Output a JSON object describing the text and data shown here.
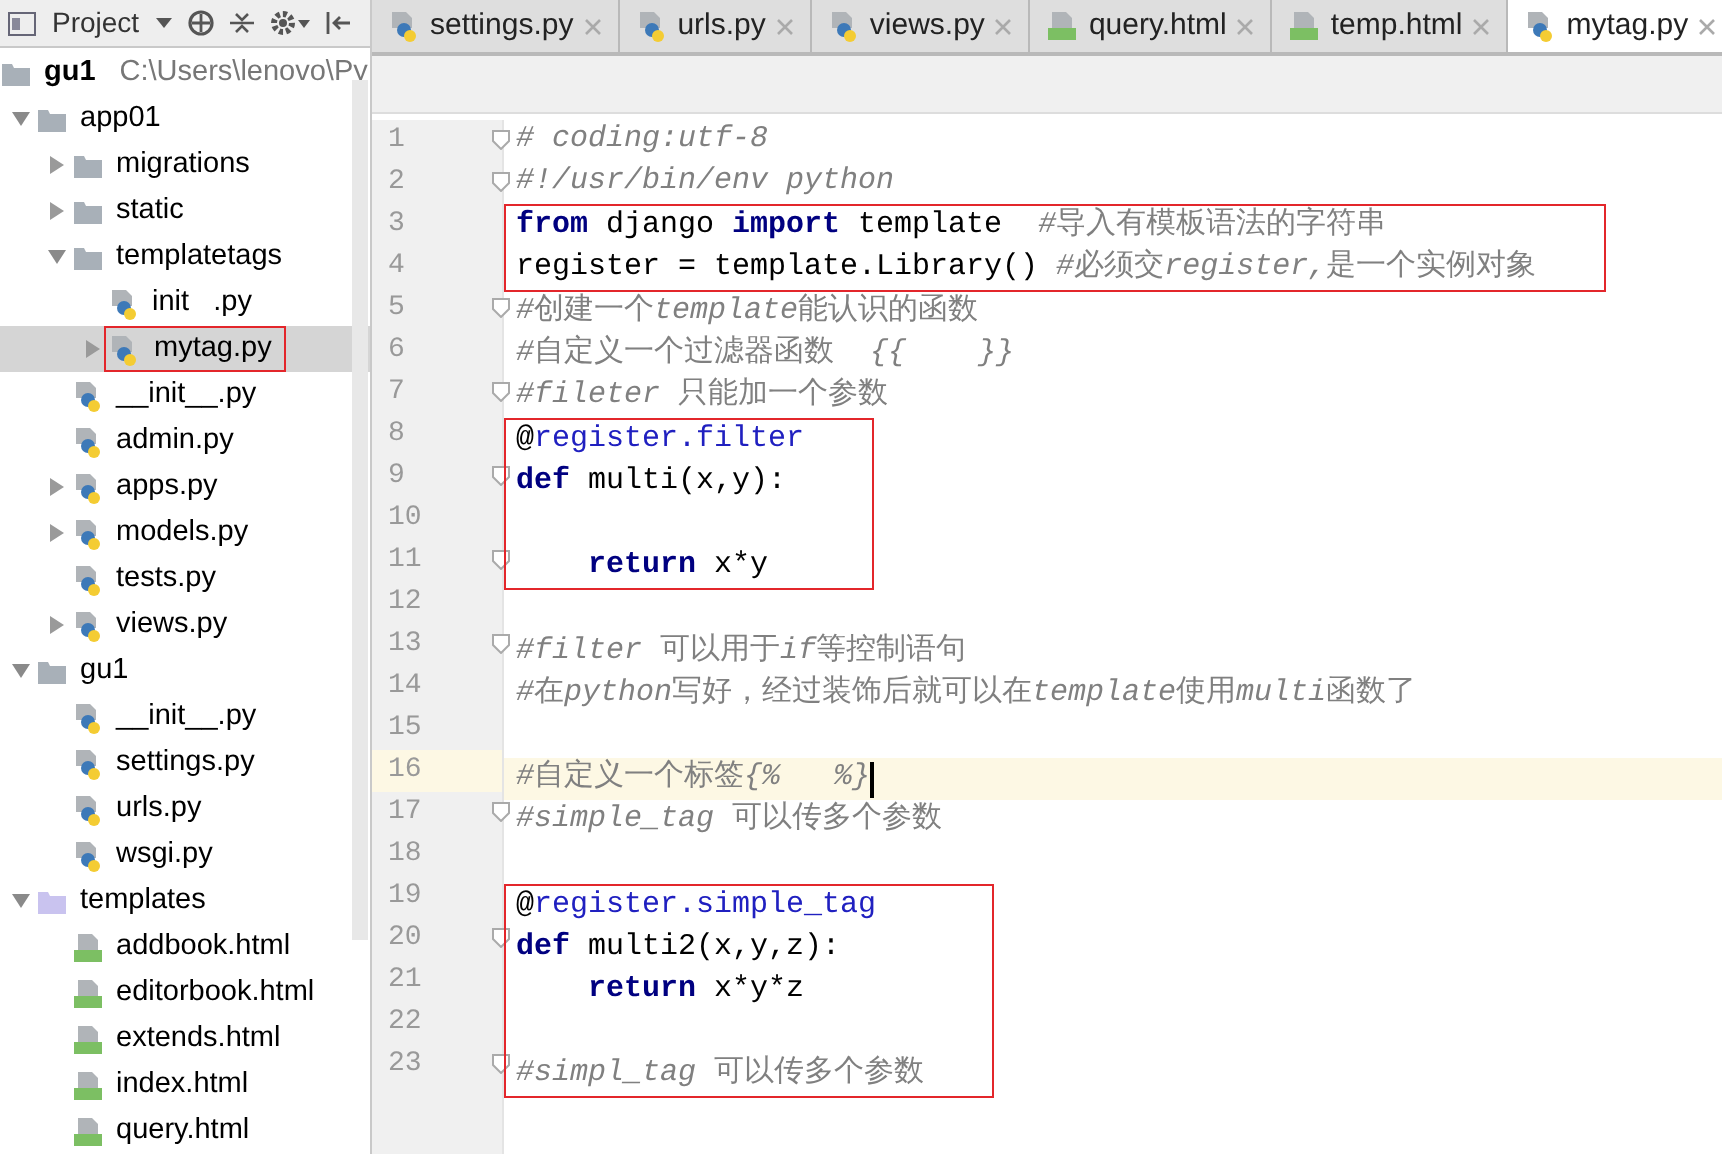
{
  "project_toolbar": {
    "title": "Project"
  },
  "tabs": [
    {
      "label": "settings.py",
      "kind": "python",
      "selected": false
    },
    {
      "label": "urls.py",
      "kind": "python",
      "selected": false
    },
    {
      "label": "views.py",
      "kind": "python",
      "selected": false
    },
    {
      "label": "query.html",
      "kind": "html",
      "selected": false
    },
    {
      "label": "temp.html",
      "kind": "html",
      "selected": false
    },
    {
      "label": "mytag.py",
      "kind": "python",
      "selected": true
    }
  ],
  "tree": [
    {
      "label": "gu1",
      "path": "C:\\Users\\lenovo\\Py",
      "kind": "folder",
      "selected": false,
      "annotated": false,
      "children": [
        {
          "label": "app01",
          "kind": "folder",
          "expanded": true,
          "selected": false,
          "annotated": false,
          "children": [
            {
              "label": "migrations",
              "kind": "folder",
              "expanded": false,
              "selected": false,
              "annotated": false
            },
            {
              "label": "static",
              "kind": "folder",
              "expanded": false,
              "selected": false,
              "annotated": false
            },
            {
              "label": "templatetags",
              "kind": "folder",
              "expanded": true,
              "selected": false,
              "annotated": false,
              "children": [
                {
                  "label": "init   .py",
                  "kind": "python",
                  "selected": false,
                  "annotated": false
                },
                {
                  "label": "mytag.py",
                  "kind": "python",
                  "expanded": false,
                  "selected": true,
                  "annotated": true
                }
              ]
            },
            {
              "label": "__init__.py",
              "kind": "python",
              "selected": false,
              "annotated": false
            },
            {
              "label": "admin.py",
              "kind": "python",
              "selected": false,
              "annotated": false
            },
            {
              "label": "apps.py",
              "kind": "python",
              "expanded": false,
              "selected": false,
              "annotated": false
            },
            {
              "label": "models.py",
              "kind": "python",
              "expanded": false,
              "selected": false,
              "annotated": false
            },
            {
              "label": "tests.py",
              "kind": "python",
              "selected": false,
              "annotated": false
            },
            {
              "label": "views.py",
              "kind": "python",
              "expanded": false,
              "selected": false,
              "annotated": false
            }
          ]
        },
        {
          "label": "gu1",
          "kind": "folder",
          "expanded": true,
          "selected": false,
          "annotated": false,
          "children": [
            {
              "label": "__init__.py",
              "kind": "python",
              "selected": false,
              "annotated": false
            },
            {
              "label": "settings.py",
              "kind": "python",
              "selected": false,
              "annotated": false
            },
            {
              "label": "urls.py",
              "kind": "python",
              "selected": false,
              "annotated": false
            },
            {
              "label": "wsgi.py",
              "kind": "python",
              "selected": false,
              "annotated": false
            }
          ]
        },
        {
          "label": "templates",
          "kind": "resource-folder",
          "expanded": true,
          "selected": false,
          "annotated": false,
          "children": [
            {
              "label": "addbook.html",
              "kind": "html",
              "selected": false,
              "annotated": false
            },
            {
              "label": "editorbook.html",
              "kind": "html",
              "selected": false,
              "annotated": false
            },
            {
              "label": "extends.html",
              "kind": "html",
              "selected": false,
              "annotated": false
            },
            {
              "label": "index.html",
              "kind": "html",
              "selected": false,
              "annotated": false
            },
            {
              "label": "query.html",
              "kind": "html",
              "selected": false,
              "annotated": false
            }
          ]
        }
      ]
    }
  ],
  "code_blocks": [
    {
      "boxed": false,
      "lines": [
        {
          "number": "1",
          "fold": true,
          "current": false,
          "tokens": [
            {
              "kind": "comment-latin",
              "text": "# coding:utf-8"
            }
          ]
        },
        {
          "number": "2",
          "fold": true,
          "current": false,
          "tokens": [
            {
              "kind": "comment-latin",
              "text": "#!/usr/bin/env python"
            }
          ]
        }
      ]
    },
    {
      "boxed": true,
      "lines": [
        {
          "number": "3",
          "fold": false,
          "current": false,
          "tokens": [
            {
              "kind": "keyword",
              "text": "from"
            },
            {
              "kind": "plain",
              "text": " django "
            },
            {
              "kind": "keyword",
              "text": "import"
            },
            {
              "kind": "plain",
              "text": " template  "
            },
            {
              "kind": "comment-latin",
              "text": "#"
            },
            {
              "kind": "comment",
              "text": "导入有模板语法的字符串"
            }
          ]
        },
        {
          "number": "4",
          "fold": false,
          "current": false,
          "tokens": [
            {
              "kind": "plain",
              "text": "register = template.Library() "
            },
            {
              "kind": "comment-latin",
              "text": "#"
            },
            {
              "kind": "comment",
              "text": "必须交"
            },
            {
              "kind": "comment-latin",
              "text": "register,"
            },
            {
              "kind": "comment",
              "text": "是一个实例对象"
            }
          ]
        }
      ]
    },
    {
      "boxed": false,
      "lines": [
        {
          "number": "5",
          "fold": true,
          "current": false,
          "tokens": [
            {
              "kind": "comment-latin",
              "text": "#"
            },
            {
              "kind": "comment",
              "text": "创建一个"
            },
            {
              "kind": "comment-latin",
              "text": "template"
            },
            {
              "kind": "comment",
              "text": "能认识的函数"
            }
          ]
        },
        {
          "number": "6",
          "fold": false,
          "current": false,
          "tokens": [
            {
              "kind": "comment-latin",
              "text": "#"
            },
            {
              "kind": "comment",
              "text": "自定义一个过滤器函数  "
            },
            {
              "kind": "comment-latin",
              "text": "{{    }}"
            }
          ]
        },
        {
          "number": "7",
          "fold": true,
          "current": false,
          "tokens": [
            {
              "kind": "comment-latin",
              "text": "#fileter"
            },
            {
              "kind": "comment",
              "text": " 只能加一个参数"
            }
          ]
        }
      ]
    },
    {
      "boxed": true,
      "lines": [
        {
          "number": "8",
          "fold": false,
          "current": false,
          "tokens": [
            {
              "kind": "plain",
              "text": "@"
            },
            {
              "kind": "decorator",
              "text": "register.filter"
            }
          ]
        },
        {
          "number": "9",
          "fold": true,
          "current": false,
          "tokens": [
            {
              "kind": "keyword",
              "text": "def"
            },
            {
              "kind": "plain",
              "text": " multi(x,y):"
            }
          ]
        },
        {
          "number": "10",
          "fold": false,
          "current": false
        },
        {
          "number": "11",
          "fold": true,
          "current": false,
          "indented": true,
          "tokens": [
            {
              "kind": "keyword",
              "text": "return"
            },
            {
              "kind": "plain",
              "text": " x*y"
            }
          ]
        }
      ]
    },
    {
      "boxed": false,
      "lines": [
        {
          "number": "12",
          "fold": false,
          "current": false
        },
        {
          "number": "13",
          "fold": true,
          "current": false,
          "tokens": [
            {
              "kind": "comment-latin",
              "text": "#filter"
            },
            {
              "kind": "comment",
              "text": " 可以用于"
            },
            {
              "kind": "comment-latin",
              "text": "if"
            },
            {
              "kind": "comment",
              "text": "等控制语句"
            }
          ]
        },
        {
          "number": "14",
          "fold": false,
          "current": false,
          "tokens": [
            {
              "kind": "comment-latin",
              "text": "#"
            },
            {
              "kind": "comment",
              "text": "在"
            },
            {
              "kind": "comment-latin",
              "text": "python"
            },
            {
              "kind": "comment",
              "text": "写好，经过装饰后就可以在"
            },
            {
              "kind": "comment-latin",
              "text": "template"
            },
            {
              "kind": "comment",
              "text": "使用"
            },
            {
              "kind": "comment-latin",
              "text": "multi"
            },
            {
              "kind": "comment",
              "text": "函数了"
            }
          ]
        },
        {
          "number": "15",
          "fold": false,
          "current": false
        },
        {
          "number": "16",
          "fold": false,
          "current": true,
          "tokens": [
            {
              "kind": "comment-latin",
              "text": "#"
            },
            {
              "kind": "comment",
              "text": "自定义一个标签"
            },
            {
              "kind": "comment-latin",
              "text": "{%   %}"
            }
          ]
        },
        {
          "number": "17",
          "fold": true,
          "current": false,
          "tokens": [
            {
              "kind": "comment-latin",
              "text": "#simple_tag"
            },
            {
              "kind": "comment",
              "text": " 可以传多个参数"
            }
          ]
        },
        {
          "number": "18",
          "fold": false,
          "current": false
        }
      ]
    },
    {
      "boxed": true,
      "lines": [
        {
          "number": "19",
          "fold": false,
          "current": false,
          "tokens": [
            {
              "kind": "plain",
              "text": "@"
            },
            {
              "kind": "decorator",
              "text": "register.simple_tag"
            }
          ]
        },
        {
          "number": "20",
          "fold": true,
          "current": false,
          "tokens": [
            {
              "kind": "keyword",
              "text": "def"
            },
            {
              "kind": "plain",
              "text": " multi2(x,y,z):"
            }
          ]
        },
        {
          "number": "21",
          "fold": false,
          "current": false,
          "indented": true,
          "tokens": [
            {
              "kind": "keyword",
              "text": "return"
            },
            {
              "kind": "plain",
              "text": " x*y*z"
            }
          ]
        },
        {
          "number": "22",
          "fold": false,
          "current": false
        },
        {
          "number": "23",
          "fold": true,
          "current": false,
          "tokens": [
            {
              "kind": "comment-latin",
              "text": "#simpl_tag"
            },
            {
              "kind": "comment",
              "text": " 可以传多个参数"
            }
          ]
        }
      ]
    }
  ]
}
